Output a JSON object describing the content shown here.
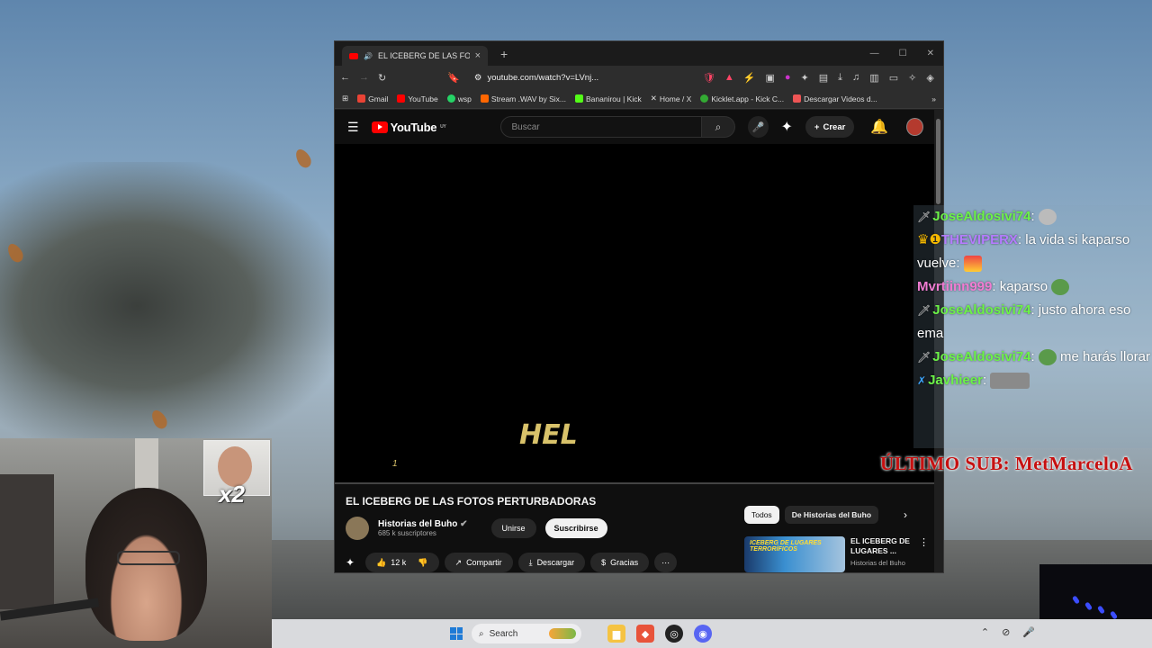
{
  "browser": {
    "tab_title": "EL ICEBERG DE LAS FOTOS PE",
    "new_tab": "+",
    "close_tab": "×",
    "url": "youtube.com/watch?v=LVnj...",
    "bookmarks": [
      "Gmail",
      "YouTube",
      "wsp",
      "Stream .WAV by Six...",
      "Bananirou | Kick",
      "Home / X",
      "Kicklet.app - Kick C...",
      "Descargar Videos d..."
    ],
    "bookmarks_more": "»"
  },
  "youtube": {
    "logo": "YouTube",
    "logo_country": "UY",
    "search_placeholder": "Buscar",
    "create_label": "Crear",
    "video_overlay_text": "HEL",
    "video_overlay_number": "1",
    "video_title": "EL ICEBERG DE LAS FOTOS PERTURBADORAS",
    "channel_name": "Historias del Buho",
    "channel_subs": "685 k suscriptores",
    "join_label": "Unirse",
    "subscribe_label": "Suscribirse",
    "likes": "12 k",
    "share_label": "Compartir",
    "download_label": "Descargar",
    "thanks_label": "Gracias",
    "filter_all": "Todos",
    "filter_channel": "De Historias del Buho",
    "rec_thumb_text": "ICEBERG DE LUGARES TERRORÍFICOS",
    "rec_title": "EL ICEBERG DE LUGARES ...",
    "rec_channel": "Historias del Buho"
  },
  "chat": [
    {
      "user": "JoseAldosivi74",
      "color": "green",
      "msg": ""
    },
    {
      "user": "THEVIPERX",
      "color": "purple",
      "msg": "la vida si kaparso vuelve:"
    },
    {
      "user": "Mvrtiinn999",
      "color": "pink",
      "msg": "kaparso"
    },
    {
      "user": "JoseAldosivi74",
      "color": "green",
      "msg": "justo ahora eso ema"
    },
    {
      "user": "JoseAldosivi74",
      "color": "green",
      "msg": "me harás llorar"
    },
    {
      "user": "Javhieer",
      "color": "blue",
      "msg": ""
    }
  ],
  "last_sub": "ÚLTIMO SUB: MetMarceloA",
  "multiplier": "x2",
  "taskbar": {
    "search_label": "Search"
  },
  "colors": {
    "youtube_red": "#ff0000",
    "chat_green": "#6cf248",
    "chat_purple": "#b57cff",
    "chat_pink": "#f07cd2",
    "sub_red": "#c61010"
  }
}
